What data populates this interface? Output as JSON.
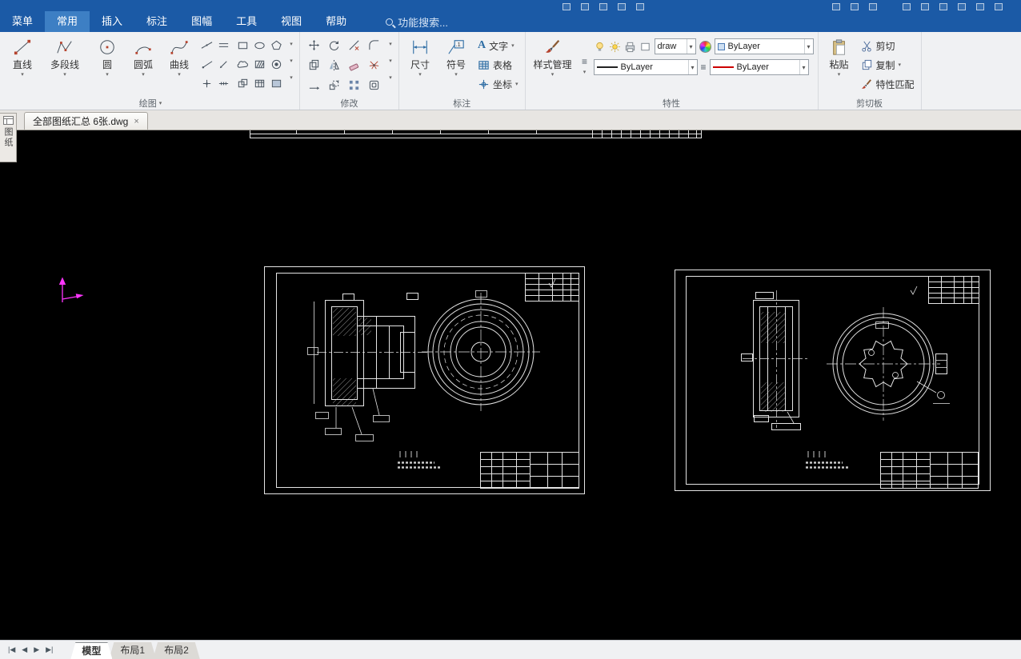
{
  "icons": {
    "dropdown_arrow": "▾",
    "close_tab": "×",
    "list_glyph": "≡",
    "text_glyph": "A",
    "symbol_glyph": ".1",
    "nav_first": "|◀",
    "nav_prev": "◀",
    "nav_next": "▶",
    "nav_last": "▶|"
  },
  "menubar": {
    "search_placeholder": "功能搜索...",
    "items": [
      {
        "label": "菜单"
      },
      {
        "label": "常用",
        "active": true
      },
      {
        "label": "插入"
      },
      {
        "label": "标注"
      },
      {
        "label": "图幅"
      },
      {
        "label": "工具"
      },
      {
        "label": "视图"
      },
      {
        "label": "帮助"
      }
    ]
  },
  "ribbon": {
    "draw": {
      "label": "绘图",
      "tools": [
        {
          "label": "直线"
        },
        {
          "label": "多段线"
        },
        {
          "label": "圆"
        },
        {
          "label": "圆弧"
        },
        {
          "label": "曲线"
        }
      ]
    },
    "modify": {
      "label": "修改"
    },
    "annotate": {
      "label": "标注",
      "big": [
        {
          "label": "尺寸"
        },
        {
          "label": "符号"
        }
      ],
      "small": [
        {
          "label": "文字"
        },
        {
          "label": "表格"
        },
        {
          "label": "坐标"
        }
      ]
    },
    "properties": {
      "label": "特性",
      "style_manager": "样式管理",
      "plot_style": "draw",
      "layer_value": "ByLayer",
      "linetype_value": "ByLayer",
      "color_value": "ByLayer"
    },
    "clipboard": {
      "label": "剪切板",
      "paste": "粘贴",
      "cut": "剪切",
      "copy": "复制",
      "match": "特性匹配"
    }
  },
  "document_tab": {
    "label": "全部图纸汇总 6张.dwg"
  },
  "left_panel": {
    "label": "图纸"
  },
  "statusbar": {
    "tabs": [
      {
        "label": "模型",
        "active": true
      },
      {
        "label": "布局1"
      },
      {
        "label": "布局2"
      }
    ]
  },
  "colors": {
    "titlebar_blue": "#1b5aa6",
    "active_menu_blue": "#3d7fc4",
    "canvas_black": "#000000",
    "drawing_line": "#e4e4e4",
    "ucs_magenta": "#ff35ff",
    "bylayer_red": "#cc0000"
  }
}
